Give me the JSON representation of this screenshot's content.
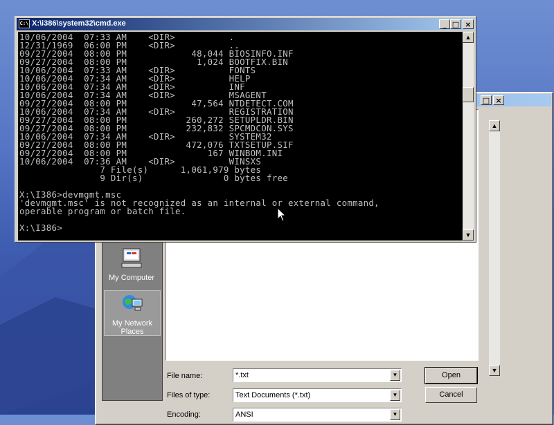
{
  "colors": {
    "desktop_top": "#6e8fd2",
    "dialog_face": "#d4d0c8",
    "console_bg": "#000000",
    "console_text": "#c0c0c0",
    "titlebar_active": "#0a246a"
  },
  "cmd_window": {
    "title": "X:\\i386\\system32\\cmd.exe",
    "icon": "C:\\",
    "buttons": {
      "minimize": "_",
      "maximize": "□",
      "close": "×"
    },
    "lines": [
      "10/06/2004  07:33 AM    <DIR>          .",
      "12/31/1969  06:00 PM    <DIR>          ..",
      "09/27/2004  08:00 PM            48,044 BIOSINFO.INF",
      "09/27/2004  08:00 PM             1,024 BOOTFIX.BIN",
      "10/06/2004  07:33 AM    <DIR>          FONTS",
      "10/06/2004  07:34 AM    <DIR>          HELP",
      "10/06/2004  07:34 AM    <DIR>          INF",
      "10/06/2004  07:34 AM    <DIR>          MSAGENT",
      "09/27/2004  08:00 PM            47,564 NTDETECT.COM",
      "10/06/2004  07:34 AM    <DIR>          REGISTRATION",
      "09/27/2004  08:00 PM           260,272 SETUPLDR.BIN",
      "09/27/2004  08:00 PM           232,832 SPCMDCON.SYS",
      "10/06/2004  07:34 AM    <DIR>          SYSTEM32",
      "09/27/2004  08:00 PM           472,076 TXTSETUP.SIF",
      "09/27/2004  08:00 PM               167 WINBOM.INI",
      "10/06/2004  07:36 AM    <DIR>          WINSXS",
      "               7 File(s)      1,061,979 bytes",
      "               9 Dir(s)               0 bytes free",
      "",
      "X:\\I386>devmgmt.msc",
      "'devmgmt.msc' is not recognized as an internal or external command,",
      "operable program or batch file.",
      "",
      "X:\\I386>"
    ]
  },
  "open_dialog": {
    "buttons": {
      "maximize": "□",
      "close": "×"
    },
    "places": [
      {
        "label": "My Computer",
        "icon": "my-computer-icon"
      },
      {
        "label": "My Network Places",
        "icon": "network-places-icon"
      }
    ],
    "file_name_label": "File name:",
    "file_name_value": "*.txt",
    "files_of_type_label": "Files of type:",
    "files_of_type_value": "Text Documents (*.txt)",
    "encoding_label": "Encoding:",
    "encoding_value": "ANSI",
    "open_button": "Open",
    "cancel_button": "Cancel"
  }
}
